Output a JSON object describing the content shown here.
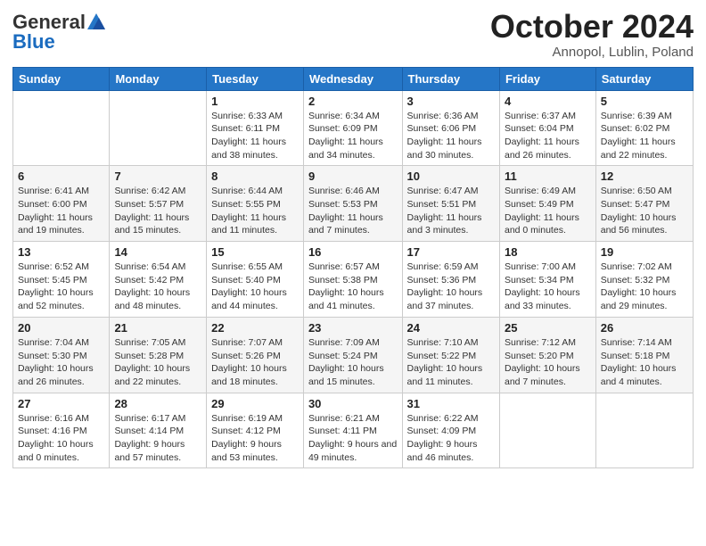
{
  "header": {
    "logo_general": "General",
    "logo_blue": "Blue",
    "month_title": "October 2024",
    "location": "Annopol, Lublin, Poland"
  },
  "weekdays": [
    "Sunday",
    "Monday",
    "Tuesday",
    "Wednesday",
    "Thursday",
    "Friday",
    "Saturday"
  ],
  "weeks": [
    [
      {
        "day": "",
        "info": ""
      },
      {
        "day": "",
        "info": ""
      },
      {
        "day": "1",
        "info": "Sunrise: 6:33 AM\nSunset: 6:11 PM\nDaylight: 11 hours and 38 minutes."
      },
      {
        "day": "2",
        "info": "Sunrise: 6:34 AM\nSunset: 6:09 PM\nDaylight: 11 hours and 34 minutes."
      },
      {
        "day": "3",
        "info": "Sunrise: 6:36 AM\nSunset: 6:06 PM\nDaylight: 11 hours and 30 minutes."
      },
      {
        "day": "4",
        "info": "Sunrise: 6:37 AM\nSunset: 6:04 PM\nDaylight: 11 hours and 26 minutes."
      },
      {
        "day": "5",
        "info": "Sunrise: 6:39 AM\nSunset: 6:02 PM\nDaylight: 11 hours and 22 minutes."
      }
    ],
    [
      {
        "day": "6",
        "info": "Sunrise: 6:41 AM\nSunset: 6:00 PM\nDaylight: 11 hours and 19 minutes."
      },
      {
        "day": "7",
        "info": "Sunrise: 6:42 AM\nSunset: 5:57 PM\nDaylight: 11 hours and 15 minutes."
      },
      {
        "day": "8",
        "info": "Sunrise: 6:44 AM\nSunset: 5:55 PM\nDaylight: 11 hours and 11 minutes."
      },
      {
        "day": "9",
        "info": "Sunrise: 6:46 AM\nSunset: 5:53 PM\nDaylight: 11 hours and 7 minutes."
      },
      {
        "day": "10",
        "info": "Sunrise: 6:47 AM\nSunset: 5:51 PM\nDaylight: 11 hours and 3 minutes."
      },
      {
        "day": "11",
        "info": "Sunrise: 6:49 AM\nSunset: 5:49 PM\nDaylight: 11 hours and 0 minutes."
      },
      {
        "day": "12",
        "info": "Sunrise: 6:50 AM\nSunset: 5:47 PM\nDaylight: 10 hours and 56 minutes."
      }
    ],
    [
      {
        "day": "13",
        "info": "Sunrise: 6:52 AM\nSunset: 5:45 PM\nDaylight: 10 hours and 52 minutes."
      },
      {
        "day": "14",
        "info": "Sunrise: 6:54 AM\nSunset: 5:42 PM\nDaylight: 10 hours and 48 minutes."
      },
      {
        "day": "15",
        "info": "Sunrise: 6:55 AM\nSunset: 5:40 PM\nDaylight: 10 hours and 44 minutes."
      },
      {
        "day": "16",
        "info": "Sunrise: 6:57 AM\nSunset: 5:38 PM\nDaylight: 10 hours and 41 minutes."
      },
      {
        "day": "17",
        "info": "Sunrise: 6:59 AM\nSunset: 5:36 PM\nDaylight: 10 hours and 37 minutes."
      },
      {
        "day": "18",
        "info": "Sunrise: 7:00 AM\nSunset: 5:34 PM\nDaylight: 10 hours and 33 minutes."
      },
      {
        "day": "19",
        "info": "Sunrise: 7:02 AM\nSunset: 5:32 PM\nDaylight: 10 hours and 29 minutes."
      }
    ],
    [
      {
        "day": "20",
        "info": "Sunrise: 7:04 AM\nSunset: 5:30 PM\nDaylight: 10 hours and 26 minutes."
      },
      {
        "day": "21",
        "info": "Sunrise: 7:05 AM\nSunset: 5:28 PM\nDaylight: 10 hours and 22 minutes."
      },
      {
        "day": "22",
        "info": "Sunrise: 7:07 AM\nSunset: 5:26 PM\nDaylight: 10 hours and 18 minutes."
      },
      {
        "day": "23",
        "info": "Sunrise: 7:09 AM\nSunset: 5:24 PM\nDaylight: 10 hours and 15 minutes."
      },
      {
        "day": "24",
        "info": "Sunrise: 7:10 AM\nSunset: 5:22 PM\nDaylight: 10 hours and 11 minutes."
      },
      {
        "day": "25",
        "info": "Sunrise: 7:12 AM\nSunset: 5:20 PM\nDaylight: 10 hours and 7 minutes."
      },
      {
        "day": "26",
        "info": "Sunrise: 7:14 AM\nSunset: 5:18 PM\nDaylight: 10 hours and 4 minutes."
      }
    ],
    [
      {
        "day": "27",
        "info": "Sunrise: 6:16 AM\nSunset: 4:16 PM\nDaylight: 10 hours and 0 minutes."
      },
      {
        "day": "28",
        "info": "Sunrise: 6:17 AM\nSunset: 4:14 PM\nDaylight: 9 hours and 57 minutes."
      },
      {
        "day": "29",
        "info": "Sunrise: 6:19 AM\nSunset: 4:12 PM\nDaylight: 9 hours and 53 minutes."
      },
      {
        "day": "30",
        "info": "Sunrise: 6:21 AM\nSunset: 4:11 PM\nDaylight: 9 hours and 49 minutes."
      },
      {
        "day": "31",
        "info": "Sunrise: 6:22 AM\nSunset: 4:09 PM\nDaylight: 9 hours and 46 minutes."
      },
      {
        "day": "",
        "info": ""
      },
      {
        "day": "",
        "info": ""
      }
    ]
  ]
}
